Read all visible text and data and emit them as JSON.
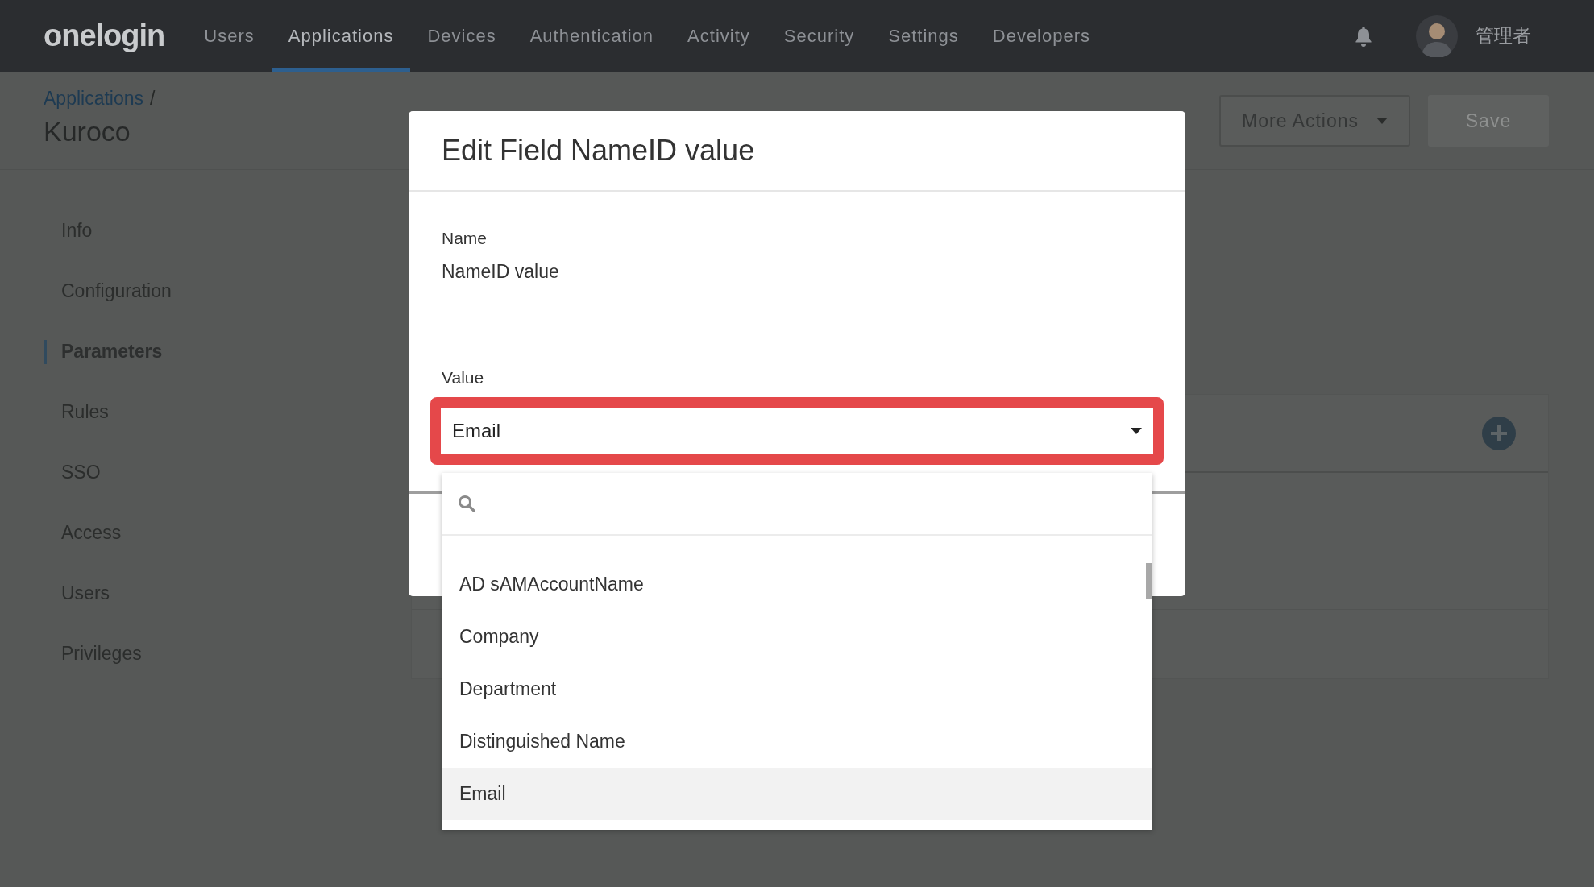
{
  "top_nav": {
    "logo": "onelogin",
    "items": [
      {
        "label": "Users",
        "selected": false
      },
      {
        "label": "Applications",
        "selected": true
      },
      {
        "label": "Devices",
        "selected": false
      },
      {
        "label": "Authentication",
        "selected": false
      },
      {
        "label": "Activity",
        "selected": false
      },
      {
        "label": "Security",
        "selected": false
      },
      {
        "label": "Settings",
        "selected": false
      },
      {
        "label": "Developers",
        "selected": false
      }
    ],
    "user": {
      "name": "管理者"
    }
  },
  "breadcrumb": {
    "parent": "Applications",
    "separator": "/",
    "title": "Kuroco"
  },
  "header_buttons": [
    {
      "label": "More Actions",
      "kind": "dropdown",
      "disabled": false
    },
    {
      "label": "Save",
      "kind": "primary",
      "disabled": true
    }
  ],
  "sidebar": {
    "items": [
      {
        "label": "Info",
        "selected": false
      },
      {
        "label": "Configuration",
        "selected": false
      },
      {
        "label": "Parameters",
        "selected": true
      },
      {
        "label": "Rules",
        "selected": false
      },
      {
        "label": "SSO",
        "selected": false
      },
      {
        "label": "Access",
        "selected": false
      },
      {
        "label": "Users",
        "selected": false
      },
      {
        "label": "Privileges",
        "selected": false
      }
    ]
  },
  "modal": {
    "title": "Edit Field NameID value",
    "fields": [
      {
        "label": "Name",
        "value": "NameID value"
      }
    ],
    "value_field": {
      "label": "Value",
      "value": "Email",
      "highlighted": true
    },
    "dropdown": {
      "options": [
        {
          "label": "AD sAMAccountName",
          "selected": false
        },
        {
          "label": "Company",
          "selected": false
        },
        {
          "label": "Department",
          "selected": false
        },
        {
          "label": "Distinguished Name",
          "selected": false
        },
        {
          "label": "Email",
          "selected": true
        }
      ]
    }
  }
}
